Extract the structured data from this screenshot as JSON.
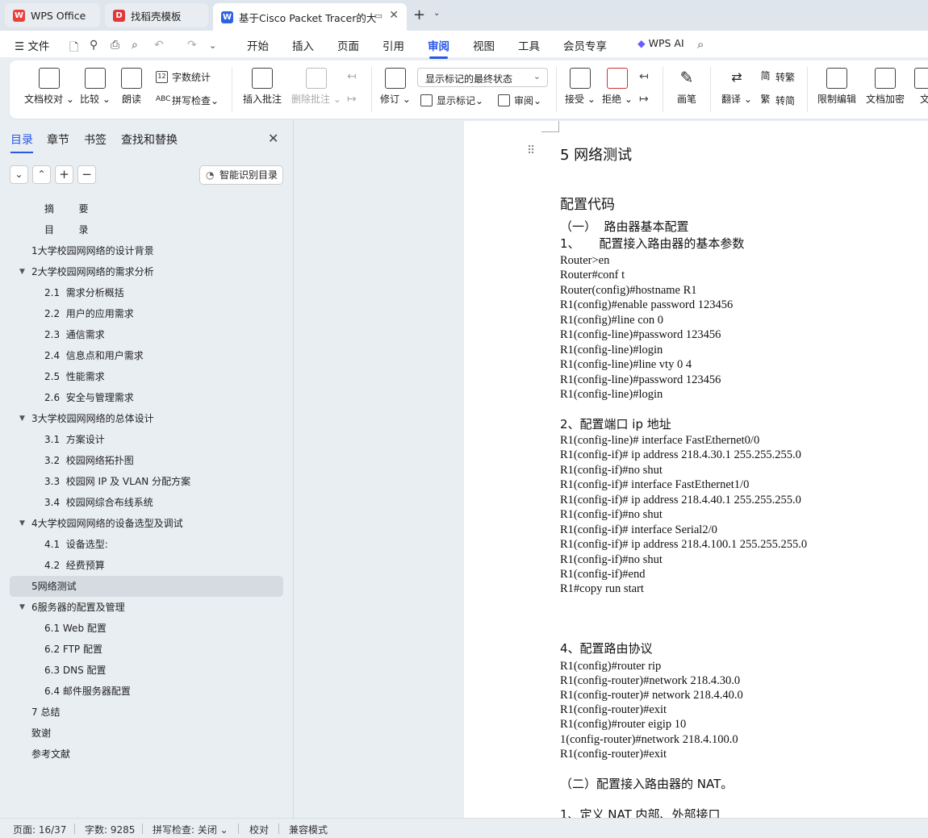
{
  "tabs": [
    {
      "label": "WPS Office"
    },
    {
      "label": "找稻壳模板"
    },
    {
      "label": "基于Cisco Packet Tracer的大"
    }
  ],
  "menu": [
    "文件",
    "开始",
    "插入",
    "页面",
    "引用",
    "审阅",
    "视图",
    "工具",
    "会员专享",
    "WPS AI"
  ],
  "ribbon": {
    "doc_check": "文档校对",
    "compare": "比较",
    "read_aloud": "朗读",
    "word_count": "字数统计",
    "spell_check": "拼写检查",
    "insert_comment": "插入批注",
    "delete_comment": "删除批注",
    "track_changes": "修订",
    "markup_dropdown": "显示标记的最终状态",
    "show_markup": "显示标记",
    "review": "审阅",
    "accept": "接受",
    "reject": "拒绝",
    "pen": "画笔",
    "translate": "翻译",
    "to_traditional": "转繁",
    "to_simplified": "转简",
    "restrict_edit": "限制编辑",
    "doc_encrypt": "文档加密",
    "doc_more": "文"
  },
  "sidebar": {
    "tabs": [
      "目录",
      "章节",
      "书签",
      "查找和替换"
    ],
    "smart_toc": "智能识别目录",
    "toc": [
      "摘        要",
      "目        录",
      "1大学校园网网络的设计背景",
      "2大学校园网网络的需求分析",
      "2.1  需求分析概括",
      "2.2  用户的应用需求",
      "2.3  通信需求",
      "2.4  信息点和用户需求",
      "2.5  性能需求",
      "2.6  安全与管理需求",
      "3大学校园网网络的总体设计",
      "3.1  方案设计",
      "3.2  校园网络拓扑图",
      "3.3  校园网 IP 及 VLAN 分配方案",
      "3.4  校园网综合布线系统",
      "4大学校园网网络的设备选型及调试",
      "4.1  设备选型:",
      "4.2  经费预算",
      "5网络测试",
      "6服务器的配置及管理",
      "6.1 Web 配置",
      "6.2 FTP 配置",
      "6.3 DNS 配置",
      "6.4 邮件服务器配置",
      "7 总结",
      "致谢",
      "参考文献"
    ]
  },
  "document": {
    "heading": "5   网络测试",
    "section": "配置代码",
    "lines": [
      "（一）  路由器基本配置",
      "1、     配置接入路由器的基本参数",
      "Router>en",
      "Router#conf t",
      "Router(config)#hostname R1",
      "R1(config)#enable password 123456",
      "R1(config)#line con 0",
      "R1(config-line)#password 123456",
      "R1(config-line)#login",
      "R1(config-line)#line vty 0 4",
      "R1(config-line)#password 123456",
      "R1(config-line)#login",
      "2、配置端口 ip 地址",
      "R1(config-line)# interface FastEthernet0/0",
      "R1(config-if)# ip address 218.4.30.1 255.255.255.0",
      "R1(config-if)#no shut",
      "R1(config-if)# interface FastEthernet1/0",
      "R1(config-if)# ip address 218.4.40.1 255.255.255.0",
      "R1(config-if)#no shut",
      "R1(config-if)# interface Serial2/0",
      "R1(config-if)# ip address 218.4.100.1 255.255.255.0",
      "R1(config-if)#no shut",
      "R1(config-if)#end",
      "R1#copy run start",
      "4、配置路由协议",
      "R1(config)#router rip",
      "R1(config-router)#network 218.4.30.0",
      "R1(config-router)# network 218.4.40.0",
      "R1(config-router)#exit",
      "R1(config)#router eigip 10",
      "1(config-router)#network 218.4.100.0",
      "R1(config-router)#exit",
      "（二）配置接入路由器的 NAT。",
      "1、定义 NAT 内部、外部接口"
    ]
  },
  "status": {
    "page": "页面: 16/37",
    "words": "字数: 9285",
    "spell": "拼写检查: 关闭",
    "proof": "校对",
    "compat": "兼容模式"
  },
  "colors": {
    "accent": "#2858e6",
    "wps_red": "#e8403b",
    "docer_red": "#e1393a",
    "writer_blue": "#2d63e0"
  }
}
